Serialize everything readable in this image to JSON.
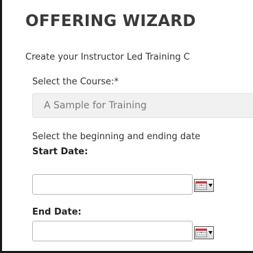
{
  "wizard": {
    "title": "OFFERING WIZARD",
    "intro_text": "Create your Instructor Led Training C",
    "course": {
      "label": "Select the Course:*",
      "selected_value": "A Sample for Training"
    },
    "date_range_text": "Select the beginning and ending date",
    "start_date": {
      "label": "Start Date:",
      "value": ""
    },
    "end_date": {
      "label": "End Date:",
      "value": ""
    }
  },
  "icons": {
    "calendar_picker": "calendar-icon",
    "dropdown_arrow": "caret-down-icon"
  },
  "colors": {
    "title": "#3a3a3a",
    "calendar_accent": "#cc2b2b"
  }
}
